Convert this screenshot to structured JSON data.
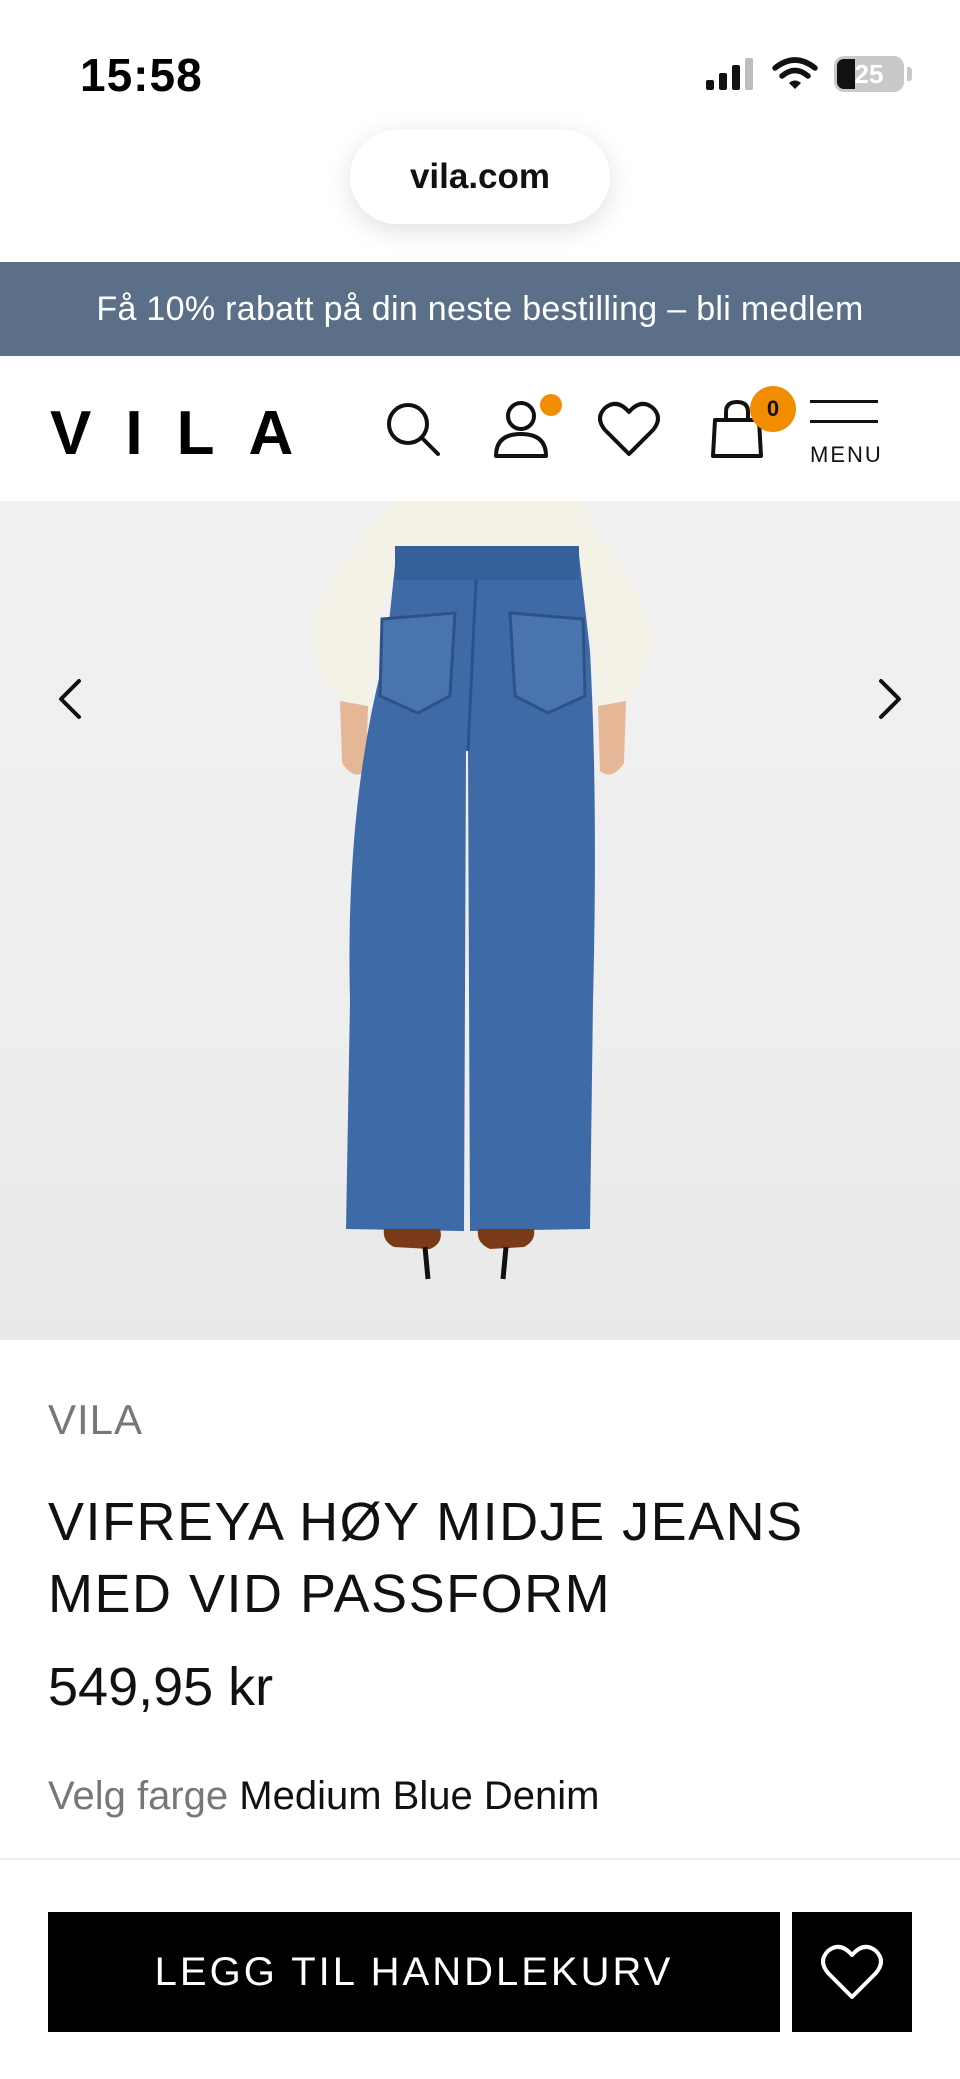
{
  "status_bar": {
    "time": "15:58",
    "battery": "25"
  },
  "browser": {
    "url": "vila.com"
  },
  "promo": {
    "text": "Få 10% rabatt på din neste bestilling – bli medlem"
  },
  "header": {
    "logo": "VILA",
    "icons": [
      "search-icon",
      "account-icon",
      "heart-icon",
      "bag-icon",
      "hamburger-icon"
    ],
    "cart_count": "0",
    "menu_label": "MENU",
    "accent_color": "#f28c00"
  },
  "product": {
    "brand": "VILA",
    "title": "VIFREYA HØY MIDJE JEANS MED VID PASSFORM",
    "price": "549,95 kr",
    "color_label": "Velg farge",
    "color_value": "Medium Blue Denim"
  },
  "actions": {
    "add_to_cart": "LEGG TIL HANDLEKURV"
  },
  "colors": {
    "banner": "#5b6f88",
    "primary_button": "#000000",
    "denim": "#3f6aa8"
  }
}
